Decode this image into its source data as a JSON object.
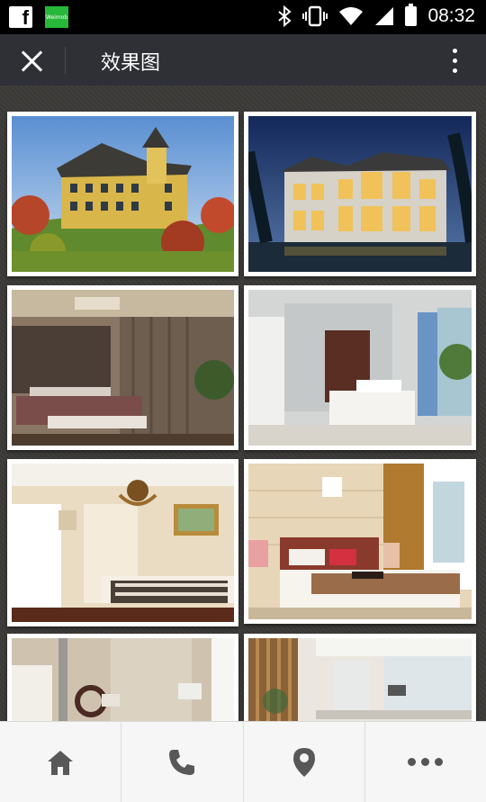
{
  "status_bar": {
    "app_badge": "Weimob",
    "time": "08:32"
  },
  "header": {
    "title": "效果图"
  },
  "gallery": {
    "images": [
      {
        "scene": "villa-exterior-day"
      },
      {
        "scene": "villa-exterior-night"
      },
      {
        "scene": "bedroom-dark-headboard"
      },
      {
        "scene": "bedroom-white-blue-curtain"
      },
      {
        "scene": "bedroom-chandelier"
      },
      {
        "scene": "bedroom-red-pillow"
      },
      {
        "scene": "living-room-partial"
      },
      {
        "scene": "kitchen-partial"
      }
    ]
  },
  "bottom_nav": {
    "items": [
      {
        "icon": "home-icon"
      },
      {
        "icon": "phone-icon"
      },
      {
        "icon": "location-pin-icon"
      },
      {
        "icon": "more-icon"
      }
    ]
  }
}
